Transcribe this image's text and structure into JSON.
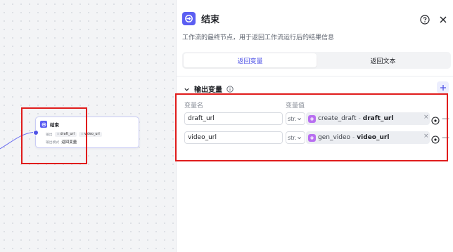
{
  "canvas": {
    "node": {
      "title": "结束",
      "output_label": "输出",
      "output_chips": [
        {
          "prefix": "≡",
          "name": "draft_url"
        },
        {
          "prefix": "≡",
          "name": "video_url"
        }
      ],
      "mode_label": "输出模式",
      "mode_value": "返回变量"
    }
  },
  "panel": {
    "title": "结束",
    "description": "工作流的最终节点，用于返回工作流运行后的结果信息",
    "tabs": [
      {
        "label": "返回变量",
        "active": true
      },
      {
        "label": "返回文本",
        "active": false
      }
    ],
    "section": {
      "title": "输出变量",
      "info_icon": "info-icon",
      "columns": {
        "name": "变量名",
        "value": "变量值"
      },
      "rows": [
        {
          "name": "draft_url",
          "type": "str.",
          "source_node": "create_draft",
          "sep": "-",
          "source_var": "draft_url"
        },
        {
          "name": "video_url",
          "type": "str.",
          "source_node": "gen_video",
          "sep": "-",
          "source_var": "video_url"
        }
      ]
    },
    "icons": {
      "help": "help-circle-icon",
      "close": "close-icon",
      "add": "plus-icon",
      "remove": "minus-icon",
      "clear": "x-icon",
      "picker": "target-icon"
    }
  },
  "colors": {
    "accent": "#4e52e6",
    "node_icon": "#5b5ef2",
    "ref_icon": "#b86ff0",
    "highlight": "#e01c1c"
  }
}
